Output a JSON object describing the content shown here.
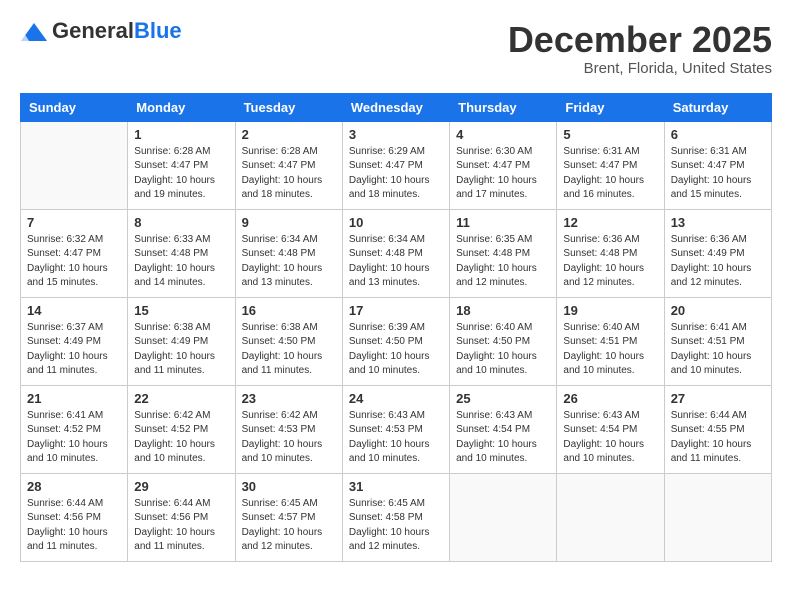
{
  "logo": {
    "general": "General",
    "blue": "Blue"
  },
  "header": {
    "month": "December 2025",
    "location": "Brent, Florida, United States"
  },
  "weekdays": [
    "Sunday",
    "Monday",
    "Tuesday",
    "Wednesday",
    "Thursday",
    "Friday",
    "Saturday"
  ],
  "weeks": [
    [
      {
        "day": "",
        "info": ""
      },
      {
        "day": "1",
        "info": "Sunrise: 6:28 AM\nSunset: 4:47 PM\nDaylight: 10 hours\nand 19 minutes."
      },
      {
        "day": "2",
        "info": "Sunrise: 6:28 AM\nSunset: 4:47 PM\nDaylight: 10 hours\nand 18 minutes."
      },
      {
        "day": "3",
        "info": "Sunrise: 6:29 AM\nSunset: 4:47 PM\nDaylight: 10 hours\nand 18 minutes."
      },
      {
        "day": "4",
        "info": "Sunrise: 6:30 AM\nSunset: 4:47 PM\nDaylight: 10 hours\nand 17 minutes."
      },
      {
        "day": "5",
        "info": "Sunrise: 6:31 AM\nSunset: 4:47 PM\nDaylight: 10 hours\nand 16 minutes."
      },
      {
        "day": "6",
        "info": "Sunrise: 6:31 AM\nSunset: 4:47 PM\nDaylight: 10 hours\nand 15 minutes."
      }
    ],
    [
      {
        "day": "7",
        "info": "Sunrise: 6:32 AM\nSunset: 4:47 PM\nDaylight: 10 hours\nand 15 minutes."
      },
      {
        "day": "8",
        "info": "Sunrise: 6:33 AM\nSunset: 4:48 PM\nDaylight: 10 hours\nand 14 minutes."
      },
      {
        "day": "9",
        "info": "Sunrise: 6:34 AM\nSunset: 4:48 PM\nDaylight: 10 hours\nand 13 minutes."
      },
      {
        "day": "10",
        "info": "Sunrise: 6:34 AM\nSunset: 4:48 PM\nDaylight: 10 hours\nand 13 minutes."
      },
      {
        "day": "11",
        "info": "Sunrise: 6:35 AM\nSunset: 4:48 PM\nDaylight: 10 hours\nand 12 minutes."
      },
      {
        "day": "12",
        "info": "Sunrise: 6:36 AM\nSunset: 4:48 PM\nDaylight: 10 hours\nand 12 minutes."
      },
      {
        "day": "13",
        "info": "Sunrise: 6:36 AM\nSunset: 4:49 PM\nDaylight: 10 hours\nand 12 minutes."
      }
    ],
    [
      {
        "day": "14",
        "info": "Sunrise: 6:37 AM\nSunset: 4:49 PM\nDaylight: 10 hours\nand 11 minutes."
      },
      {
        "day": "15",
        "info": "Sunrise: 6:38 AM\nSunset: 4:49 PM\nDaylight: 10 hours\nand 11 minutes."
      },
      {
        "day": "16",
        "info": "Sunrise: 6:38 AM\nSunset: 4:50 PM\nDaylight: 10 hours\nand 11 minutes."
      },
      {
        "day": "17",
        "info": "Sunrise: 6:39 AM\nSunset: 4:50 PM\nDaylight: 10 hours\nand 10 minutes."
      },
      {
        "day": "18",
        "info": "Sunrise: 6:40 AM\nSunset: 4:50 PM\nDaylight: 10 hours\nand 10 minutes."
      },
      {
        "day": "19",
        "info": "Sunrise: 6:40 AM\nSunset: 4:51 PM\nDaylight: 10 hours\nand 10 minutes."
      },
      {
        "day": "20",
        "info": "Sunrise: 6:41 AM\nSunset: 4:51 PM\nDaylight: 10 hours\nand 10 minutes."
      }
    ],
    [
      {
        "day": "21",
        "info": "Sunrise: 6:41 AM\nSunset: 4:52 PM\nDaylight: 10 hours\nand 10 minutes."
      },
      {
        "day": "22",
        "info": "Sunrise: 6:42 AM\nSunset: 4:52 PM\nDaylight: 10 hours\nand 10 minutes."
      },
      {
        "day": "23",
        "info": "Sunrise: 6:42 AM\nSunset: 4:53 PM\nDaylight: 10 hours\nand 10 minutes."
      },
      {
        "day": "24",
        "info": "Sunrise: 6:43 AM\nSunset: 4:53 PM\nDaylight: 10 hours\nand 10 minutes."
      },
      {
        "day": "25",
        "info": "Sunrise: 6:43 AM\nSunset: 4:54 PM\nDaylight: 10 hours\nand 10 minutes."
      },
      {
        "day": "26",
        "info": "Sunrise: 6:43 AM\nSunset: 4:54 PM\nDaylight: 10 hours\nand 10 minutes."
      },
      {
        "day": "27",
        "info": "Sunrise: 6:44 AM\nSunset: 4:55 PM\nDaylight: 10 hours\nand 11 minutes."
      }
    ],
    [
      {
        "day": "28",
        "info": "Sunrise: 6:44 AM\nSunset: 4:56 PM\nDaylight: 10 hours\nand 11 minutes."
      },
      {
        "day": "29",
        "info": "Sunrise: 6:44 AM\nSunset: 4:56 PM\nDaylight: 10 hours\nand 11 minutes."
      },
      {
        "day": "30",
        "info": "Sunrise: 6:45 AM\nSunset: 4:57 PM\nDaylight: 10 hours\nand 12 minutes."
      },
      {
        "day": "31",
        "info": "Sunrise: 6:45 AM\nSunset: 4:58 PM\nDaylight: 10 hours\nand 12 minutes."
      },
      {
        "day": "",
        "info": ""
      },
      {
        "day": "",
        "info": ""
      },
      {
        "day": "",
        "info": ""
      }
    ]
  ]
}
